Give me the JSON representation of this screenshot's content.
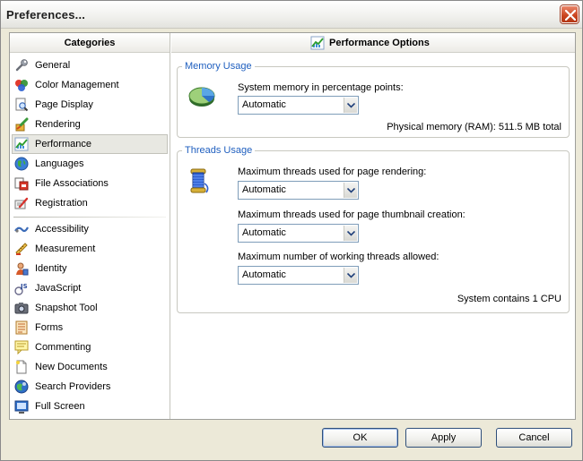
{
  "window": {
    "title": "Preferences...",
    "close_label": "Close"
  },
  "categories": {
    "header": "Categories",
    "selected": "Performance",
    "groups": [
      [
        {
          "label": "General",
          "icon": "wrench-icon"
        },
        {
          "label": "Color Management",
          "icon": "palette-icon"
        },
        {
          "label": "Page Display",
          "icon": "page-magnifier-icon"
        },
        {
          "label": "Rendering",
          "icon": "rendering-brush-icon"
        },
        {
          "label": "Performance",
          "icon": "performance-chart-icon"
        },
        {
          "label": "Languages",
          "icon": "globe-icon"
        },
        {
          "label": "File Associations",
          "icon": "file-associations-icon"
        },
        {
          "label": "Registration",
          "icon": "registration-pen-icon"
        }
      ],
      [
        {
          "label": "Accessibility",
          "icon": "accessibility-icon"
        },
        {
          "label": "Measurement",
          "icon": "ruler-icon"
        },
        {
          "label": "Identity",
          "icon": "person-icon"
        },
        {
          "label": "JavaScript",
          "icon": "javascript-icon"
        },
        {
          "label": "Snapshot Tool",
          "icon": "camera-icon"
        },
        {
          "label": "Forms",
          "icon": "form-icon"
        },
        {
          "label": "Commenting",
          "icon": "comment-icon"
        },
        {
          "label": "New Documents",
          "icon": "new-document-icon"
        },
        {
          "label": "Search Providers",
          "icon": "search-globe-icon"
        },
        {
          "label": "Full Screen",
          "icon": "full-screen-icon"
        }
      ]
    ]
  },
  "panel": {
    "header": "Performance Options",
    "memory": {
      "title": "Memory Usage",
      "field_label": "System memory in percentage points:",
      "value": "Automatic",
      "info": "Physical memory (RAM): 511.5 MB total"
    },
    "threads": {
      "title": "Threads Usage",
      "fields": [
        {
          "label": "Maximum threads used for page rendering:",
          "value": "Automatic"
        },
        {
          "label": "Maximum threads used for page thumbnail creation:",
          "value": "Automatic"
        },
        {
          "label": "Maximum number of working threads allowed:",
          "value": "Automatic"
        }
      ],
      "info": "System contains 1 CPU"
    }
  },
  "buttons": {
    "ok": "OK",
    "apply": "Apply",
    "cancel": "Cancel"
  },
  "colors": {
    "accent_text": "#1f5fbf",
    "selection_bg": "#e8e8e2",
    "close_button": "#c9431e"
  }
}
